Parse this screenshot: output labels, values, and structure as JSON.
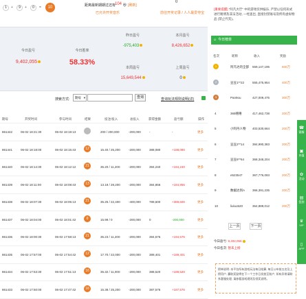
{
  "lottery": {
    "balls": [
      "1",
      "9",
      "0"
    ],
    "ops": [
      "+",
      "+",
      "="
    ],
    "sum": "10",
    "next_draw_text": "距离最新期期过还有",
    "countdown": "104",
    "countdown_unit": "秒",
    "countdown_tag": "[刷新]",
    "open_sound": "已允许开奖音乐",
    "balance_zero": "0",
    "deposit_link": "前往开奖记录 / 人人最爱夺宝"
  },
  "stats": {
    "today_profit_label": "今日盈亏",
    "today_profit": "9,402,055",
    "today_rate_label": "今日胜率",
    "today_rate": "58.33%",
    "yesterday_label": "昨日盈亏",
    "yesterday": "-975,403",
    "month_label": "本月盈亏",
    "month": "8,426,652",
    "week_label": "本周盈亏",
    "week": "15,649,544",
    "lastweek_label": "上周盈亏",
    "lastweek": "0"
  },
  "search": {
    "label": "搜索方式:",
    "select": "期号",
    "button": "查询",
    "link": "查询玩法规则说明(详)"
  },
  "table": {
    "headers": [
      "期号",
      "开奖时间",
      "参与时间",
      "结果",
      "投注/投入",
      "总投入",
      "获得金额",
      "盈亏额",
      "操作"
    ],
    "rows": [
      {
        "issue": "861442",
        "draw": "06-02 18:21:30",
        "join": "06-02 18:19:13",
        "res": "",
        "bet": "200 / 200,000",
        "total": "-200,000",
        "win": "-",
        "profit": "-",
        "op": "更多"
      },
      {
        "issue": "861441",
        "draw": "06-02 18:18:00",
        "join": "06-02 18:15:43",
        "res": "12",
        "bet": "15.40 / 25,200",
        "total": "-200,000",
        "win": "388,080",
        "profit": "+188,080",
        "op": "更多"
      },
      {
        "issue": "861440",
        "draw": "06-02 18:14:30",
        "join": "06-02 18:12:12",
        "res": "21",
        "bet": "35.20 / 11,200",
        "total": "-200,000",
        "win": "394,240",
        "profit": "+194,240",
        "op": "更多"
      },
      {
        "issue": "861439",
        "draw": "06-02 18:11:00",
        "join": "06-02 18:08:43",
        "res": "13",
        "bet": "13.18 / 28,200",
        "total": "-200,000",
        "win": "384,856",
        "profit": "+184,856",
        "op": "更多"
      },
      {
        "issue": "861438",
        "draw": "06-02 18:07:30",
        "join": "06-02 18:05:13",
        "res": "21",
        "bet": "35.25 / 22,400",
        "total": "-400,000",
        "win": "789,600",
        "profit": "+389,600",
        "op": "更多"
      },
      {
        "issue": "861437",
        "draw": "06-02 18:04:00",
        "join": "06-02 18:01:42",
        "res": "0",
        "bet": "15.99 / 0",
        "total": "-200,000",
        "win": "0",
        "profit": "-200,000",
        "op": "更多"
      },
      {
        "issue": "861436",
        "draw": "06-02 18:00:30",
        "join": "06-02 17:58:13",
        "res": "21",
        "bet": "35.23 / 11,200",
        "total": "-200,000",
        "win": "394,576",
        "profit": "+194,576",
        "op": "更多"
      },
      {
        "issue": "861435",
        "draw": "06-02 17:57:00",
        "join": "06-02 17:54:42",
        "res": "12",
        "bet": "17.70 / 22,000",
        "total": "-200,000",
        "win": "389,401",
        "profit": "+189,401",
        "op": "更多"
      },
      {
        "issue": "861434",
        "draw": "06-02 17:53:30",
        "join": "06-02 17:51:13",
        "res": "16",
        "bet": "35.32 / 11,000",
        "total": "-200,000",
        "win": "388,520",
        "profit": "+188,520",
        "op": "更多"
      },
      {
        "issue": "861433",
        "draw": "06-02 17:50:00",
        "join": "06-02 17:47:42",
        "res": "16",
        "bet": "15.38 / 25,200",
        "total": "-200,000",
        "win": "387,576",
        "profit": "+187,576",
        "op": "更多"
      }
    ]
  },
  "notice": {
    "title": "[重要提醒]",
    "text": "\"阿凡大厅\" 中的游戏仅供娱乐, 严禁以任何形式进行赌博及非法活动, 一经查出, 直接封禁账号及所有虚拟物品 (禁止代充)。"
  },
  "ranking": {
    "title": "今日榜单",
    "headers": [
      "名次",
      "昵称",
      "收入",
      "奖励"
    ],
    "rows": [
      {
        "rank": "1",
        "name": "阿凡达的全部",
        "income": "559,147,195",
        "reward": "600万"
      },
      {
        "rank": "2",
        "name": "豆豆1**22",
        "income": "555,475,954",
        "reward": "400万"
      },
      {
        "rank": "3",
        "name": "Pan9ou",
        "income": "427,009,475",
        "reward": "300万"
      },
      {
        "rank": "4",
        "name": "365嘻嘻",
        "income": "417,462,738",
        "reward": "200万"
      },
      {
        "rank": "5",
        "name": "小阿丹人物",
        "income": "403,530,664",
        "reward": "200万"
      },
      {
        "rank": "6",
        "name": "豆豆2**14",
        "income": "384,990,383",
        "reward": "200万"
      },
      {
        "rank": "7",
        "name": "豆豆6**64",
        "income": "368,348,204",
        "reward": "200万"
      },
      {
        "rank": "8",
        "name": "e523547",
        "income": "367,776,093",
        "reward": "200万"
      },
      {
        "rank": "9",
        "name": "数据达到A",
        "income": "366,391,235",
        "reward": "200万"
      },
      {
        "rank": "10",
        "name": "liuluo520",
        "income": "364,889,012",
        "reward": "200万"
      }
    ],
    "prev": "上一页",
    "next": "下一页",
    "my_profit_label": "今日盈亏:",
    "my_profit": "9,402,055",
    "my_rank_label": "今日名次:",
    "my_rank": "暂未上榜"
  },
  "rules": {
    "text": "榜单说明: 本平台所有游戏玩法每日结算, 每日公布前五名及上榜用户, 赢取奖励将在下一个工作日发放至账户, 如有异常请联系客服处理, 请参看游戏规则及领奖说明。"
  },
  "sidebar": [
    "客服",
    "充值",
    "活动",
    "签到",
    "VIP",
    "APP"
  ]
}
